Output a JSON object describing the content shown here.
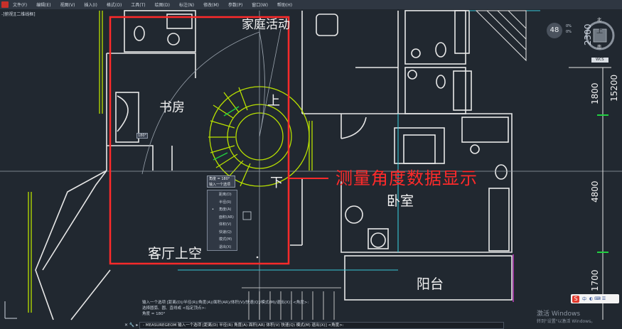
{
  "menu": {
    "items": [
      "文件(F)",
      "编辑(E)",
      "视图(V)",
      "插入(I)",
      "格式(O)",
      "工具(T)",
      "绘图(D)",
      "标注(N)",
      "修改(M)",
      "参数(P)",
      "窗口(W)",
      "帮助(H)"
    ]
  },
  "viewport_label": "-]俯视][二维线框]",
  "room_labels": {
    "activity": "家庭活动",
    "study": "书房",
    "up": "上",
    "down": "下",
    "living_void": "客厅上空",
    "bedroom": "卧室",
    "balcony": "阳台"
  },
  "annotation": "测量角度数据显示",
  "measure_tip": {
    "line1": "角度 = 180°",
    "line2": "输入一个选项"
  },
  "angle_tag": "180°",
  "context_menu": {
    "items": [
      "距离(D)",
      "半径(R)",
      "角度(A)",
      "面积(AR)",
      "体积(V)",
      "快速(Q)",
      "模式(M)",
      "退出(X)"
    ],
    "selected": 2
  },
  "command": {
    "hist1": "输入一个选项 [距离(D)/半径(R)/角度(A)/面积(AR)/体积(V)/快速(Q)/模式(M)/退出(X)] <角度>:",
    "hist2": "选择圆弧、圆、直线或 <指定顶点>:",
    "hist3": "角度 = 180°",
    "line": "- MEASUREGEOM 输入一个选项 [距离(D) 半径(R) 角度(A) 面积(AR) 体积(V) 快速(Q) 模式(M) 退出(X)] <角度>:"
  },
  "viewcube": {
    "zoom": "48",
    "north": "北",
    "top_face": "上",
    "south": "南",
    "wcs": "WCS",
    "opt1": "0%",
    "opt2": "0%"
  },
  "dimensions": {
    "d1": "2300",
    "d2": "1800",
    "d3": "4800",
    "d4": "1700",
    "d5": "15200"
  },
  "windows": {
    "activate": "激活 Windows",
    "hint": "转到\"设置\"以激活 Windows。"
  },
  "ime": {
    "logo": "S",
    "lang": "中"
  },
  "colors": {
    "background": "#212830",
    "highlight": "#ff2a2a",
    "wall": "#e8e8e8",
    "stair": "#b8e000",
    "cyan": "#38c8d8",
    "green": "#20d040"
  }
}
